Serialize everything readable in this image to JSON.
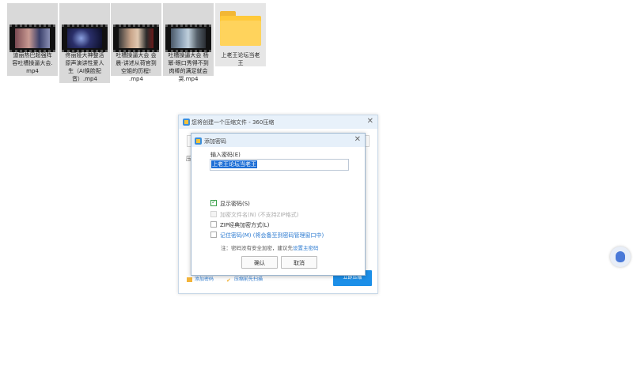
{
  "desktop": {
    "files": [
      {
        "name": "迪丽热巴超强阵容吐槽操逼大会.mp4",
        "lines": [
          "迪丽热巴超强阵",
          "容吐槽操逼大会.",
          "mp4"
        ],
        "type": "video"
      },
      {
        "name": "佟丽娅大神整活原声演讲性爱人生（AI换脸配音）.mp4",
        "lines": [
          "佟丽娅大神整活",
          "原声演讲性爱人",
          "生（AI换脸配",
          "音）.mp4"
        ],
        "type": "video"
      },
      {
        "name": "吐槽操逼大会 会晨-讲述从荷官到空姐的历程!.mp4",
        "lines": [
          "吐槽操逼大会 会",
          "晨-讲述从荷官到",
          "空姐的历程!",
          ".mp4"
        ],
        "type": "video"
      },
      {
        "name": "吐槽操逼大会 杨幂-眼口秀得不到肉棒的满足就会哭.mp4",
        "lines": [
          "吐槽操逼大会 杨",
          "幂-眼口秀得不到",
          "肉棒的满足就会",
          "哭.mp4"
        ],
        "type": "video"
      },
      {
        "name": "上老王论坛当老王",
        "lines": [
          "上老王论坛当老",
          "王"
        ],
        "type": "folder"
      }
    ]
  },
  "compress_window": {
    "title": "您将创建一个压缩文件 - 360压缩",
    "close_icon": "close-icon",
    "bg_label": "压",
    "footer": {
      "password_link": "添加密码",
      "cloud_link": "压缩前先扫描",
      "compress_button": "立即压缩"
    }
  },
  "password_dialog": {
    "title": "添加密码",
    "close_icon": "close-icon",
    "password_label": "输入密码(E)",
    "password_value": "上老王论坛当老王",
    "options": {
      "show_password": {
        "label": "显示密码(S)",
        "checked": true
      },
      "encrypt_filenames": {
        "label": "加密文件名(N) (不支持ZIP格式)",
        "checked": false,
        "disabled": true
      },
      "zip_classic": {
        "label": "ZIP经典加密方式(L)",
        "checked": false
      },
      "remember_password": {
        "label": "记住密码(M) (将会备至到密码管理窗口中)",
        "checked": false
      }
    },
    "note_prefix": "注：密码没有安全加密，建议先",
    "note_link": "设置主密码",
    "ok_button": "确认",
    "cancel_button": "取消"
  },
  "colors": {
    "accent": "#1c8fe8",
    "link": "#2a79d0",
    "check": "#3aa04a",
    "folder": "#ffc93a",
    "tile_bg": "#d9d9d9"
  }
}
